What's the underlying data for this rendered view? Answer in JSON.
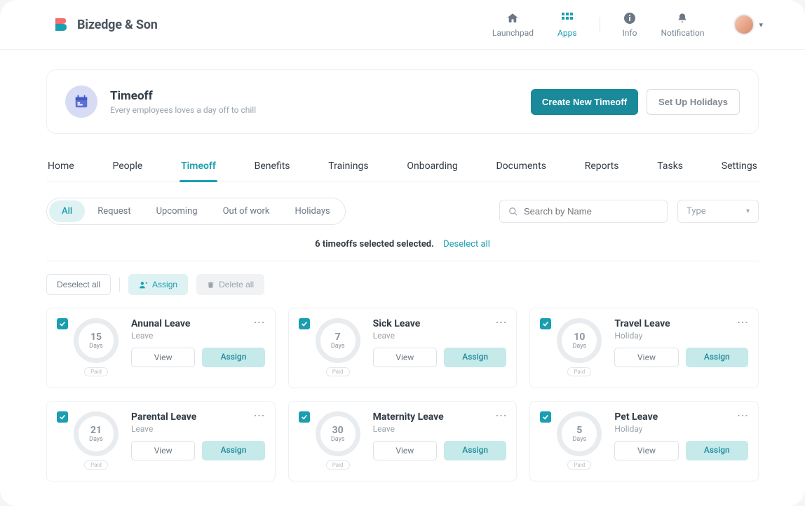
{
  "brand": {
    "name": "Bizedge & Son"
  },
  "topnav": {
    "launchpad": "Launchpad",
    "apps": "Apps",
    "info": "Info",
    "notification": "Notification"
  },
  "page": {
    "title": "Timeoff",
    "subtitle": "Every employees loves a day off to chill",
    "create_btn": "Create New Timeoff",
    "holidays_btn": "Set Up Holidays"
  },
  "tabs": {
    "home": "Home",
    "people": "People",
    "timeoff": "Timeoff",
    "benefits": "Benefits",
    "trainings": "Trainings",
    "onboarding": "Onboarding",
    "documents": "Documents",
    "reports": "Reports",
    "tasks": "Tasks",
    "settings": "Settings"
  },
  "filters": {
    "all": "All",
    "request": "Request",
    "upcoming": "Upcoming",
    "out_of_work": "Out of work",
    "holidays": "Holidays"
  },
  "search": {
    "placeholder": "Search by Name"
  },
  "type_select": {
    "label": "Type"
  },
  "selection": {
    "text": "6 timeoffs selected selected.",
    "deselect_link": "Deselect all"
  },
  "actions": {
    "deselect_all": "Deselect all",
    "assign": "Assign",
    "delete_all": "Delete all"
  },
  "card_common": {
    "days_label": "Days",
    "paid_label": "Paid",
    "view": "View",
    "assign": "Assign"
  },
  "cards": [
    {
      "title": "Anunal Leave",
      "sub": "Leave",
      "days": "15"
    },
    {
      "title": "Sick Leave",
      "sub": "Leave",
      "days": "7"
    },
    {
      "title": "Travel Leave",
      "sub": "Holiday",
      "days": "10"
    },
    {
      "title": "Parental Leave",
      "sub": "Leave",
      "days": "21"
    },
    {
      "title": "Maternity Leave",
      "sub": "Leave",
      "days": "30"
    },
    {
      "title": "Pet Leave",
      "sub": "Holiday",
      "days": "5"
    }
  ]
}
